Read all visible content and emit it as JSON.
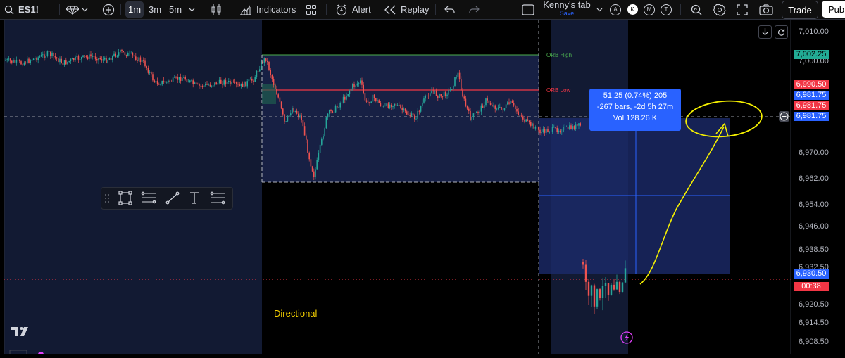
{
  "toolbar": {
    "symbol": "ES1!",
    "intervals": [
      "1m",
      "3m",
      "5m"
    ],
    "active_interval": "1m",
    "indicators_label": "Indicators",
    "alert_label": "Alert",
    "replay_label": "Replay",
    "layout_name": "Kenny's tab",
    "save_label": "Save",
    "mode_buttons": [
      "A",
      "K",
      "M",
      "T"
    ],
    "active_mode": "K",
    "trade_label": "Trade",
    "publish_label": "Pub"
  },
  "chart": {
    "price_axis": [
      "7,010.00",
      "7,000.00",
      "6,970.00",
      "6,962.00",
      "6,954.00",
      "6,946.00",
      "6,938.50",
      "6,932.50",
      "6,920.50",
      "6,914.50",
      "6,908.50"
    ],
    "price_tags": {
      "orb_high": "7,002.25",
      "tag1": "6,990.50",
      "tag2": "6,981.75",
      "tag3": "6,981.75",
      "crosshair": "6,981.75",
      "last": "6,930.50",
      "countdown": "00:38"
    },
    "orb_high_label": "ORB High",
    "orb_low_label": "ORB Low",
    "annotation_text": "Directional",
    "measure": {
      "line1": "51.25 (0.74%) 205",
      "line2": "-267 bars, -2d 5h 27m",
      "line3": "Vol 128.26 K"
    },
    "colors": {
      "up": "#26a69a",
      "down": "#ef5350",
      "orb_high": "#4caf50",
      "orb_low": "#f23645",
      "measure": "#2962ff",
      "highlight": "#f5f000",
      "directional_text": "#f5d000"
    }
  }
}
